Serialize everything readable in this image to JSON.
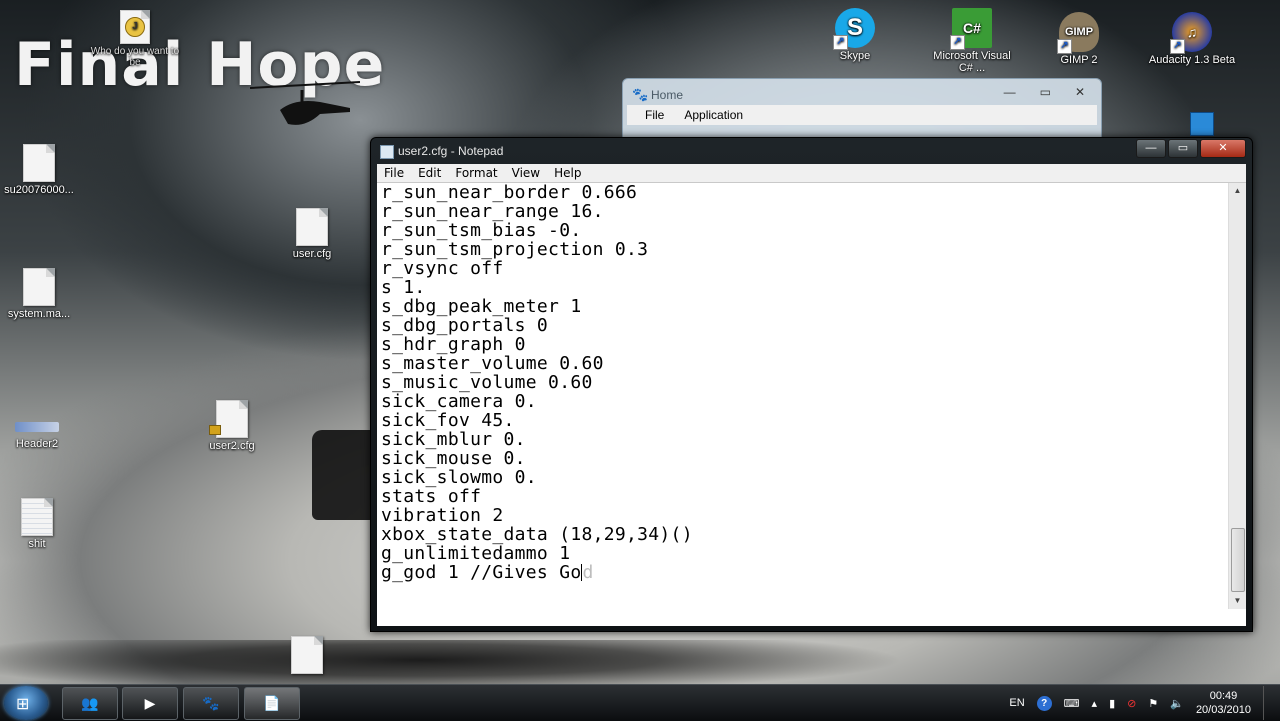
{
  "wallpaper": {
    "title": "Final Hope"
  },
  "desktop_icons": [
    {
      "label": "Who do you want to be",
      "name": "who-do-you-want-icon"
    },
    {
      "label": "su20076000...",
      "name": "document-file-icon"
    },
    {
      "label": "system.ma...",
      "name": "document-file-icon"
    },
    {
      "label": "user.cfg",
      "name": "document-file-icon"
    },
    {
      "label": "Header2",
      "name": "header2-icon"
    },
    {
      "label": "user2.cfg",
      "name": "locked-file-icon"
    },
    {
      "label": "shit",
      "name": "text-file-icon"
    },
    {
      "label": "Skype",
      "name": "skype-icon"
    },
    {
      "label": "Microsoft Visual C# ...",
      "name": "visual-csharp-icon"
    },
    {
      "label": "GIMP 2",
      "name": "gimp-icon"
    },
    {
      "label": "Audacity 1.3 Beta",
      "name": "audacity-icon"
    }
  ],
  "home_window": {
    "title": "Home",
    "menu": [
      "File",
      "Application"
    ]
  },
  "notepad": {
    "title": "user2.cfg - Notepad",
    "menu": [
      "File",
      "Edit",
      "Format",
      "View",
      "Help"
    ],
    "lines": [
      "r_sun_near_border 0.666",
      "r_sun_near_range 16.",
      "r_sun_tsm_bias -0.",
      "r_sun_tsm_projection 0.3",
      "r_vsync off",
      "s 1.",
      "s_dbg_peak_meter 1",
      "s_dbg_portals 0",
      "s_hdr_graph 0",
      "s_master_volume 0.60",
      "s_music_volume 0.60",
      "sick_camera 0.",
      "sick_fov 45.",
      "sick_mblur 0.",
      "sick_mouse 0.",
      "sick_slowmo 0.",
      "stats off",
      "vibration 2",
      "xbox_state_data (18,29,34)()",
      "g_unlimitedammo 1"
    ],
    "last_line_typed": "g_god 1 //Gives Go",
    "last_line_ghost": "d"
  },
  "taskbar": {
    "buttons": [
      "msn-messenger-icon",
      "media-player-icon",
      "dj-app-icon",
      "notepad-icon"
    ],
    "tray": {
      "language": "EN",
      "time": "00:49",
      "date": "20/03/2010"
    }
  }
}
